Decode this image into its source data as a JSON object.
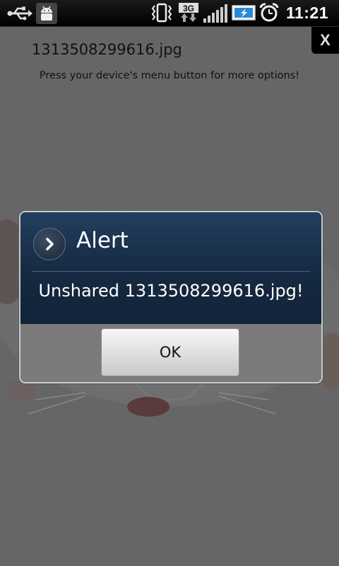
{
  "status_bar": {
    "time": "11:21",
    "icons": [
      "usb-icon",
      "android-debug-icon",
      "vibrate-icon",
      "3g-data-icon",
      "signal-icon",
      "battery-charging-icon",
      "alarm-icon"
    ],
    "network_label": "3G"
  },
  "app": {
    "close_label": "X",
    "filename": "1313508299616.jpg",
    "hint": "Press your device's menu button for more options!"
  },
  "dialog": {
    "title": "Alert",
    "message": "Unshared 1313508299616.jpg!",
    "ok_label": "OK",
    "icon": "chevron-right-icon"
  },
  "colors": {
    "dim_background": "#666666",
    "dialog_header": "#1c3350",
    "dialog_footer": "#7b7b7b"
  }
}
